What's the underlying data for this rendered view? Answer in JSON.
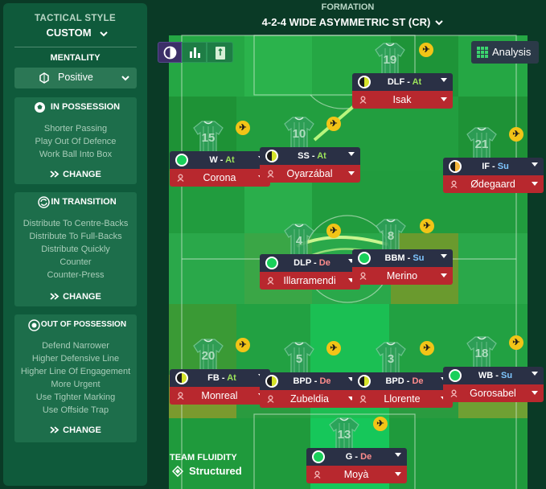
{
  "sidebar": {
    "tactical_style_label": "TACTICAL STYLE",
    "tactical_style_value": "CUSTOM",
    "mentality_label": "MENTALITY",
    "mentality_value": "Positive",
    "in_possession": {
      "title": "IN POSSESSION",
      "items": [
        "Shorter Passing",
        "Play Out Of Defence",
        "Work Ball Into Box"
      ],
      "change_label": "CHANGE"
    },
    "in_transition": {
      "title": "IN TRANSITION",
      "items": [
        "Distribute To Centre-Backs",
        "Distribute To Full-Backs",
        "Distribute Quickly",
        "Counter",
        "Counter-Press"
      ],
      "change_label": "CHANGE"
    },
    "out_of_possession": {
      "title": "OUT OF POSSESSION",
      "items": [
        "Defend Narrower",
        "Higher Defensive Line",
        "Higher Line Of Engagement",
        "More Urgent",
        "Use Tighter Marking",
        "Use Offside Trap"
      ],
      "change_label": "CHANGE"
    }
  },
  "formation": {
    "label": "FORMATION",
    "value": "4-2-4 WIDE ASYMMETRIC ST (CR)"
  },
  "toolbar": {
    "analysis_label": "Analysis"
  },
  "team_fluidity": {
    "label": "TEAM FLUIDITY",
    "value": "Structured"
  },
  "players": [
    {
      "id": "dlf",
      "role": "DLF",
      "duty": "At",
      "name": "Isak",
      "number": "19",
      "indicator": "half"
    },
    {
      "id": "w",
      "role": "W",
      "duty": "At",
      "name": "Corona",
      "number": "15",
      "indicator": "green"
    },
    {
      "id": "ss",
      "role": "SS",
      "duty": "At",
      "name": "Oyarzábal",
      "number": "10",
      "indicator": "half"
    },
    {
      "id": "if",
      "role": "IF",
      "duty": "Su",
      "name": "Ødegaard",
      "number": "21",
      "indicator": "halforange"
    },
    {
      "id": "dlp",
      "role": "DLP",
      "duty": "De",
      "name": "Illarramendi",
      "number": "4",
      "indicator": "green"
    },
    {
      "id": "bbm",
      "role": "BBM",
      "duty": "Su",
      "name": "Merino",
      "number": "8",
      "indicator": "green"
    },
    {
      "id": "fb",
      "role": "FB",
      "duty": "At",
      "name": "Monreal",
      "number": "20",
      "indicator": "half"
    },
    {
      "id": "bpd1",
      "role": "BPD",
      "duty": "De",
      "name": "Zubeldia",
      "number": "5",
      "indicator": "half"
    },
    {
      "id": "bpd2",
      "role": "BPD",
      "duty": "De",
      "name": "Llorente",
      "number": "3",
      "indicator": "half"
    },
    {
      "id": "wb",
      "role": "WB",
      "duty": "Su",
      "name": "Gorosabel",
      "number": "18",
      "indicator": "green"
    },
    {
      "id": "g",
      "role": "G",
      "duty": "De",
      "name": "Moyà",
      "number": "13",
      "indicator": "green"
    }
  ],
  "colors": {
    "duty_attack": "#9ce35a",
    "duty_defend": "#ff8c8c",
    "duty_support": "#7fc6ff",
    "name_bar": "#b8282e",
    "role_bar": "#2a3045",
    "sidebar": "#0f5a3b"
  },
  "icons": [
    "contrast-icon",
    "bar-chart-icon",
    "pitch-icon",
    "grid-icon",
    "airplane-icon",
    "ball-icon",
    "cycle-icon",
    "circle-icon",
    "chevrons-right-icon",
    "chevron-down-icon",
    "shield-icon",
    "pin-icon"
  ]
}
